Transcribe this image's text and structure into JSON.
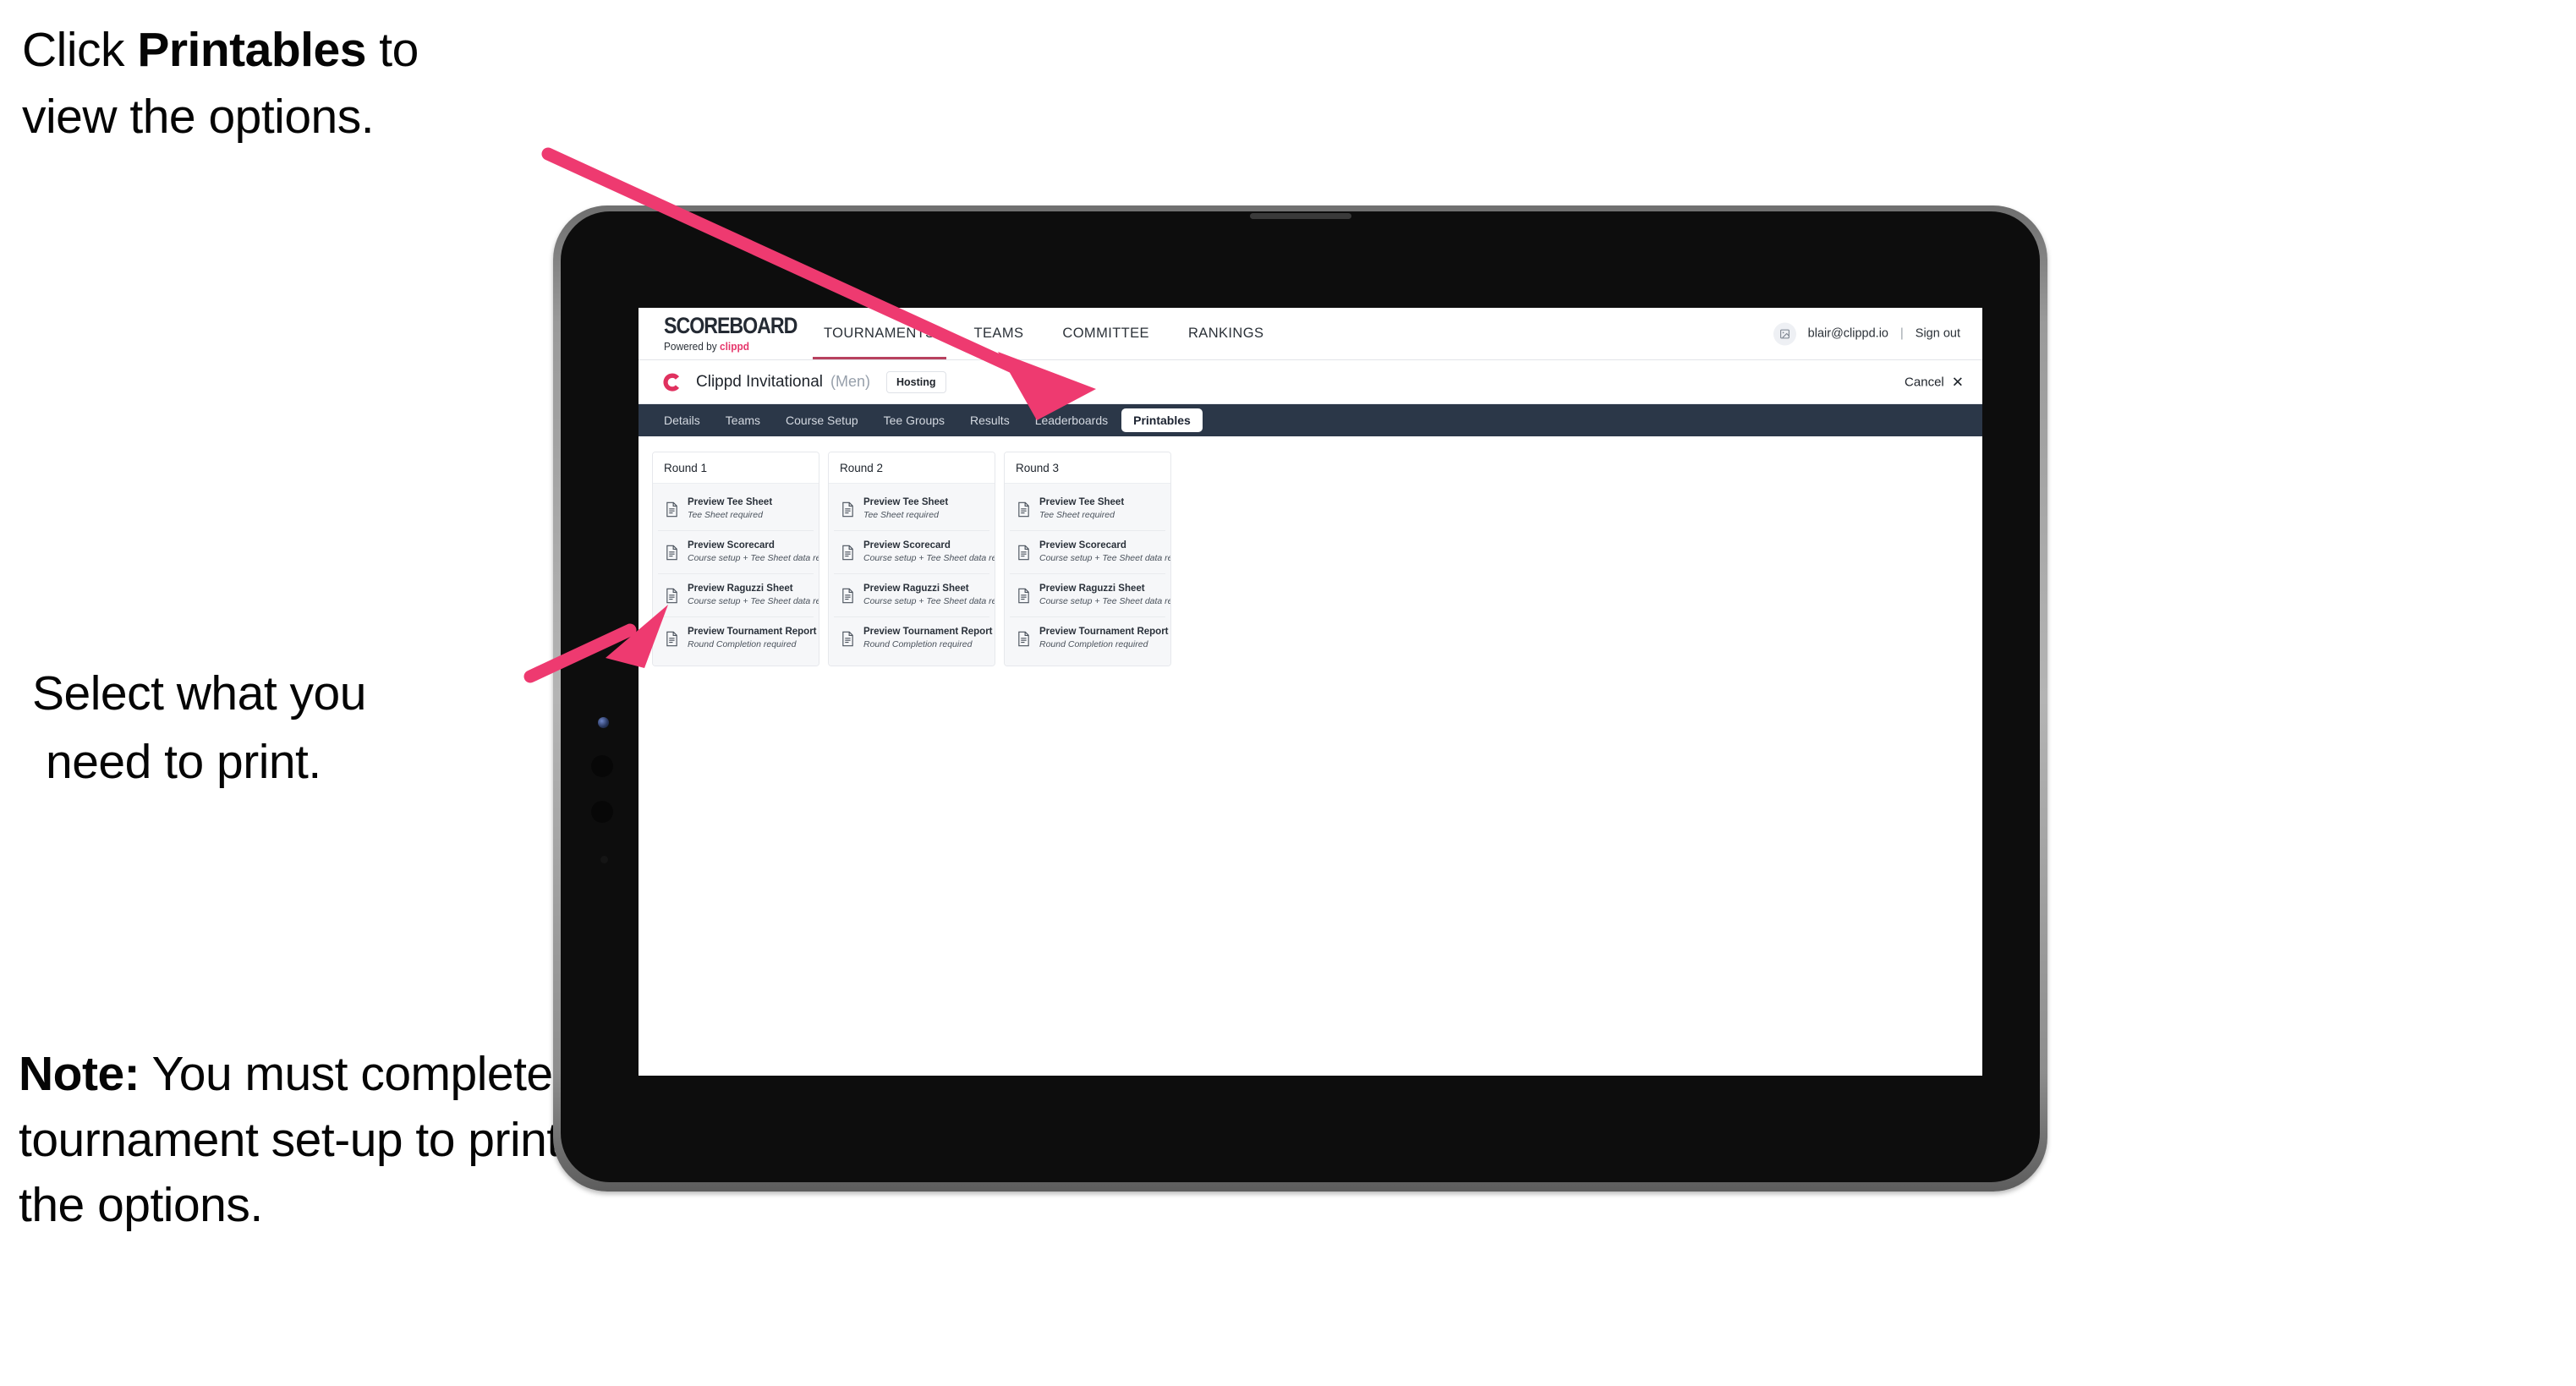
{
  "annotations": {
    "top_line1_pre": "Click ",
    "top_line1_bold": "Printables",
    "top_line1_post": " to",
    "top_line2": "view the options.",
    "mid_line1": "Select what you",
    "mid_line2": "need to print.",
    "note_bold": "Note:",
    "note_rest": " You must complete the tournament set-up to print all the options."
  },
  "colors": {
    "arrow_pink": "#EE3A70",
    "brand_pink": "#E6366B",
    "subnav_dark": "#2B3748",
    "active_underline": "#B8415F"
  },
  "browser": {
    "brand": {
      "wordmark": "SCOREBOARD",
      "tagline_pre": "Powered by ",
      "tagline_brand": "clippd"
    },
    "main_nav": [
      {
        "label": "TOURNAMENTS",
        "active": true
      },
      {
        "label": "TEAMS",
        "active": false
      },
      {
        "label": "COMMITTEE",
        "active": false
      },
      {
        "label": "RANKINGS",
        "active": false
      }
    ],
    "user": {
      "avatar_icon": "user-avatar-icon",
      "email": "blair@clippd.io",
      "divider": "|",
      "sign_out": "Sign out"
    },
    "tournament": {
      "logo_icon": "clippd-c-logo-icon",
      "name": "Clippd Invitational",
      "gender": "(Men)",
      "status_badge": "Hosting",
      "cancel_label": "Cancel",
      "cancel_icon": "close-x-icon"
    },
    "sub_nav": [
      {
        "label": "Details",
        "active": false
      },
      {
        "label": "Teams",
        "active": false
      },
      {
        "label": "Course Setup",
        "active": false
      },
      {
        "label": "Tee Groups",
        "active": false
      },
      {
        "label": "Results",
        "active": false
      },
      {
        "label": "Leaderboards",
        "active": false
      },
      {
        "label": "Printables",
        "active": true
      }
    ],
    "rounds": [
      {
        "title": "Round 1",
        "items": [
          {
            "icon": "document-icon",
            "title": "Preview Tee Sheet",
            "subtitle": "Tee Sheet required"
          },
          {
            "icon": "document-icon",
            "title": "Preview Scorecard",
            "subtitle": "Course setup + Tee Sheet data required"
          },
          {
            "icon": "document-icon",
            "title": "Preview Raguzzi Sheet",
            "subtitle": "Course setup + Tee Sheet data required"
          },
          {
            "icon": "document-icon",
            "title": "Preview Tournament Report",
            "subtitle": "Round Completion required"
          }
        ]
      },
      {
        "title": "Round 2",
        "items": [
          {
            "icon": "document-icon",
            "title": "Preview Tee Sheet",
            "subtitle": "Tee Sheet required"
          },
          {
            "icon": "document-icon",
            "title": "Preview Scorecard",
            "subtitle": "Course setup + Tee Sheet data required"
          },
          {
            "icon": "document-icon",
            "title": "Preview Raguzzi Sheet",
            "subtitle": "Course setup + Tee Sheet data required"
          },
          {
            "icon": "document-icon",
            "title": "Preview Tournament Report",
            "subtitle": "Round Completion required"
          }
        ]
      },
      {
        "title": "Round 3",
        "items": [
          {
            "icon": "document-icon",
            "title": "Preview Tee Sheet",
            "subtitle": "Tee Sheet required"
          },
          {
            "icon": "document-icon",
            "title": "Preview Scorecard",
            "subtitle": "Course setup + Tee Sheet data required"
          },
          {
            "icon": "document-icon",
            "title": "Preview Raguzzi Sheet",
            "subtitle": "Course setup + Tee Sheet data required"
          },
          {
            "icon": "document-icon",
            "title": "Preview Tournament Report",
            "subtitle": "Round Completion required"
          }
        ]
      }
    ]
  },
  "device": {
    "type": "tablet",
    "hardware": [
      "front-camera",
      "button-upper",
      "button-lower",
      "microphone",
      "speaker-slit"
    ]
  }
}
